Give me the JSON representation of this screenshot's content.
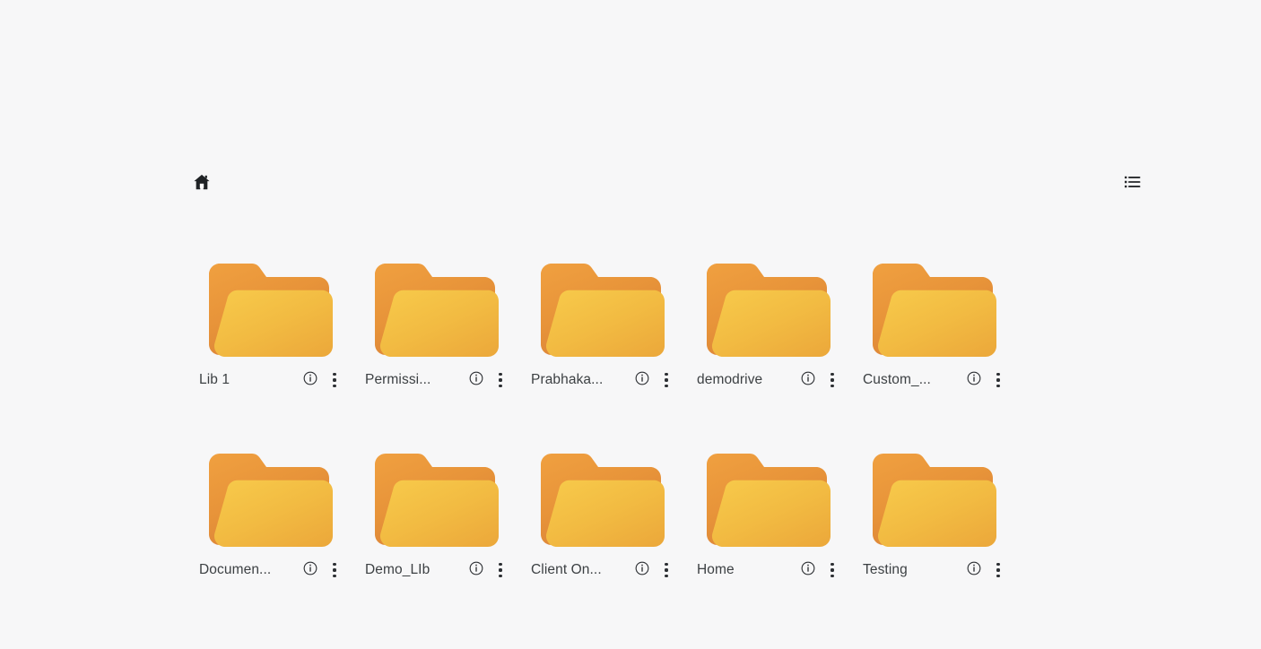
{
  "page": {
    "background_color": "#f7f7f8",
    "text_color": "#3c4043"
  },
  "toolbar": {
    "home_icon": "home-icon",
    "home_label": "Home",
    "view_toggle_icon": "list-view-icon",
    "view_toggle_label": "List view"
  },
  "folder_colors": {
    "back_top": "#ef9a3c",
    "back_bottom": "#e08a3c",
    "front_top": "#f5c344",
    "front_bottom": "#eeae3c"
  },
  "item_actions": {
    "info_icon": "info-circle-icon",
    "info_label": "Info",
    "menu_icon": "kebab-menu-icon",
    "menu_label": "More options"
  },
  "grid": {
    "columns": 5,
    "items": [
      {
        "label": "Lib 1",
        "icon": "folder-icon"
      },
      {
        "label": "Permissi...",
        "icon": "folder-icon"
      },
      {
        "label": "Prabhaka...",
        "icon": "folder-icon"
      },
      {
        "label": "demodrive",
        "icon": "folder-icon"
      },
      {
        "label": "Custom_...",
        "icon": "folder-icon"
      },
      {
        "label": "Documen...",
        "icon": "folder-icon"
      },
      {
        "label": "Demo_LIb",
        "icon": "folder-icon"
      },
      {
        "label": "Client On...",
        "icon": "folder-icon"
      },
      {
        "label": "Home",
        "icon": "folder-icon"
      },
      {
        "label": "Testing",
        "icon": "folder-icon"
      }
    ]
  }
}
